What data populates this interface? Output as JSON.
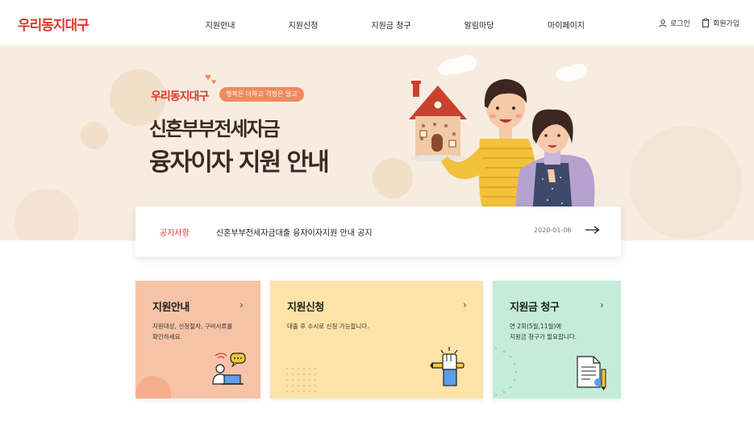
{
  "header": {
    "logo": "우리동지대구",
    "nav": [
      "지원안내",
      "지원신청",
      "지원금 청구",
      "알림마당",
      "마이페이지"
    ],
    "login": "로그인",
    "signup": "회원가입"
  },
  "hero": {
    "brand": "우리동지대구",
    "pill": "행복은 더하고 걱정은 덜고",
    "title_line1": "신혼부부전세자금",
    "title_line2": "융자이자 지원 안내"
  },
  "notice": {
    "label": "공지사항",
    "text": "신혼부부전세자금대출 융자이자지원 안내 공지",
    "date": "2020-01-06"
  },
  "cards": [
    {
      "title": "지원안내",
      "desc_line1": "지원대상, 신청절차, 구비서류를",
      "desc_line2": "확인하세요.",
      "color": "#f7c3a7"
    },
    {
      "title": "지원신청",
      "desc_line1": "대출 후 수시로 신청 가능합니다.",
      "desc_line2": "",
      "color": "#fde3a7"
    },
    {
      "title": "지원금 청구",
      "desc_line1": "연 2회(5월,11월)에",
      "desc_line2": "지원금 청구가 필요합니다.",
      "color": "#c4ecd9"
    }
  ],
  "colors": {
    "accent": "#e2352c",
    "hero_bg": "#f7ece0",
    "pill": "#f08a5d"
  }
}
